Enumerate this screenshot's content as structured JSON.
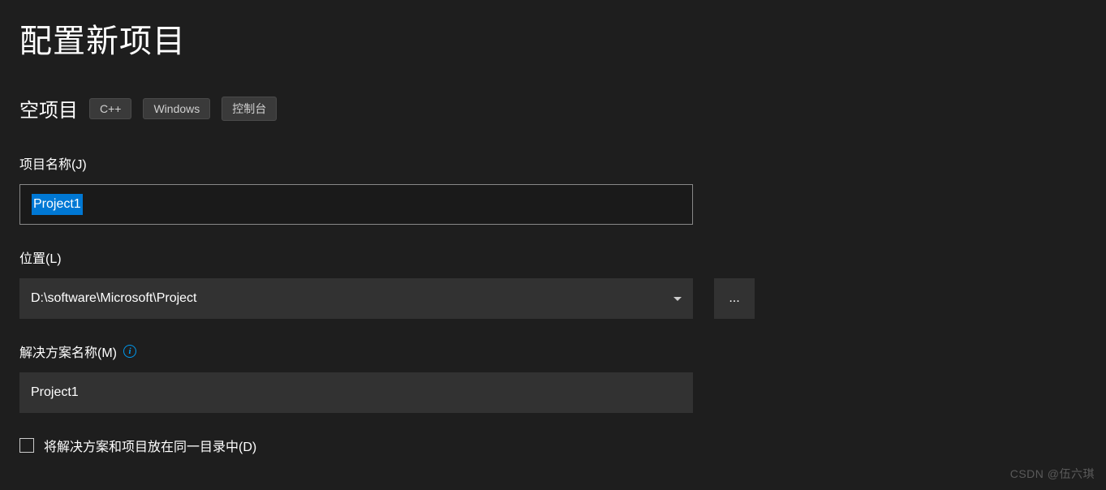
{
  "header": {
    "title": "配置新项目"
  },
  "template": {
    "name": "空项目",
    "tags": [
      "C++",
      "Windows",
      "控制台"
    ]
  },
  "form": {
    "projectName": {
      "label": "项目名称(J)",
      "value": "Project1"
    },
    "location": {
      "label": "位置(L)",
      "value": "D:\\software\\Microsoft\\Project",
      "browseLabel": "..."
    },
    "solutionName": {
      "label": "解决方案名称(M)",
      "value": "Project1"
    },
    "sameDirectory": {
      "label": "将解决方案和项目放在同一目录中(D)",
      "checked": false
    }
  },
  "watermark": "CSDN @伍六琪"
}
